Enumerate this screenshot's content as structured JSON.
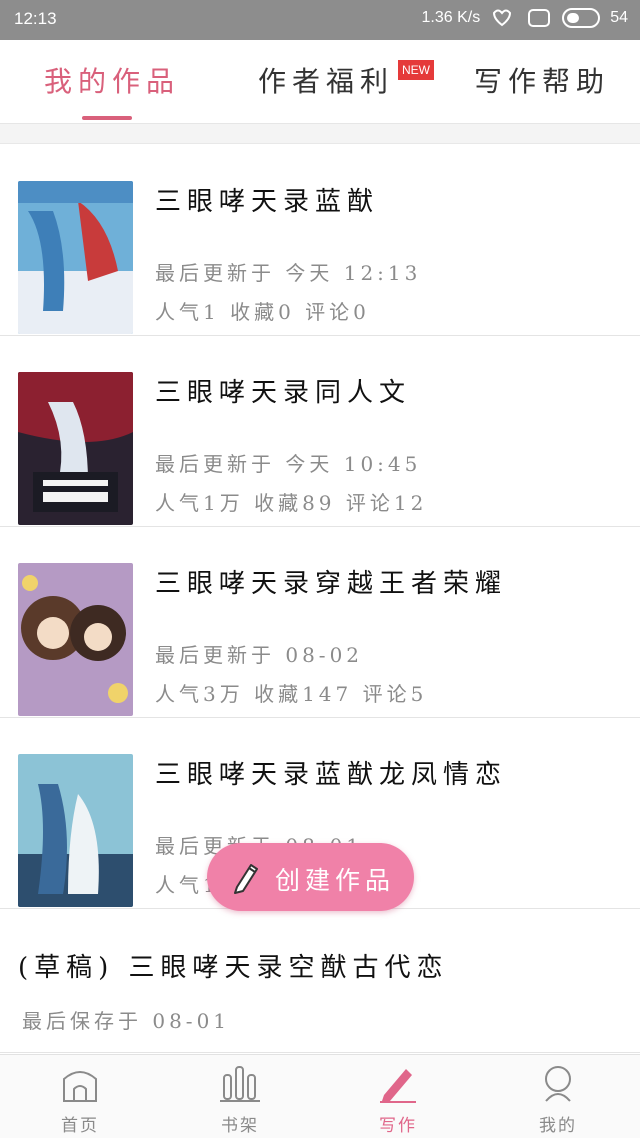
{
  "status_bar": {
    "time": "12:13",
    "network_speed": "1.36 K/s",
    "battery": "54"
  },
  "top_tabs": {
    "mine": "我的作品",
    "welfare": "作者福利",
    "new_badge": "NEW",
    "help": "写作帮助"
  },
  "works": [
    {
      "title": "三眼哮天录蓝猷",
      "update": "最后更新于 今天 12:13",
      "stats": "人气1 收藏0 评论0",
      "cover_colors": [
        "#6fb0d8",
        "#c83b3b",
        "#e9eef5"
      ]
    },
    {
      "title": "三眼哮天录同人文",
      "update": "最后更新于 今天 10:45",
      "stats": "人气1万 收藏89 评论12",
      "cover_colors": [
        "#2a2230",
        "#c23434",
        "#dfe6ef"
      ]
    },
    {
      "title": "三眼哮天录穿越王者荣耀",
      "update": "最后更新于 08-02",
      "stats": "人气3万 收藏147 评论5",
      "cover_colors": [
        "#b59ac4",
        "#5a3a2a",
        "#f0d36a"
      ]
    },
    {
      "title": "三眼哮天录蓝猷龙凤情恋",
      "update": "最后更新于 08-01",
      "stats": "人气1 收藏0 评论0",
      "cover_colors": [
        "#8cc3d6",
        "#2d4e6e",
        "#eef3f6"
      ]
    }
  ],
  "draft": {
    "title": "(草稿) 三眼哮天录空猷古代恋",
    "saved": "最后保存于 08-01"
  },
  "create_button": {
    "label": "创建作品",
    "icon": "pencil-icon",
    "color": "#f081a8"
  },
  "bottom_nav": {
    "home": "首页",
    "shelf": "书架",
    "write": "写作",
    "me": "我的",
    "active_color": "#e0668a"
  }
}
